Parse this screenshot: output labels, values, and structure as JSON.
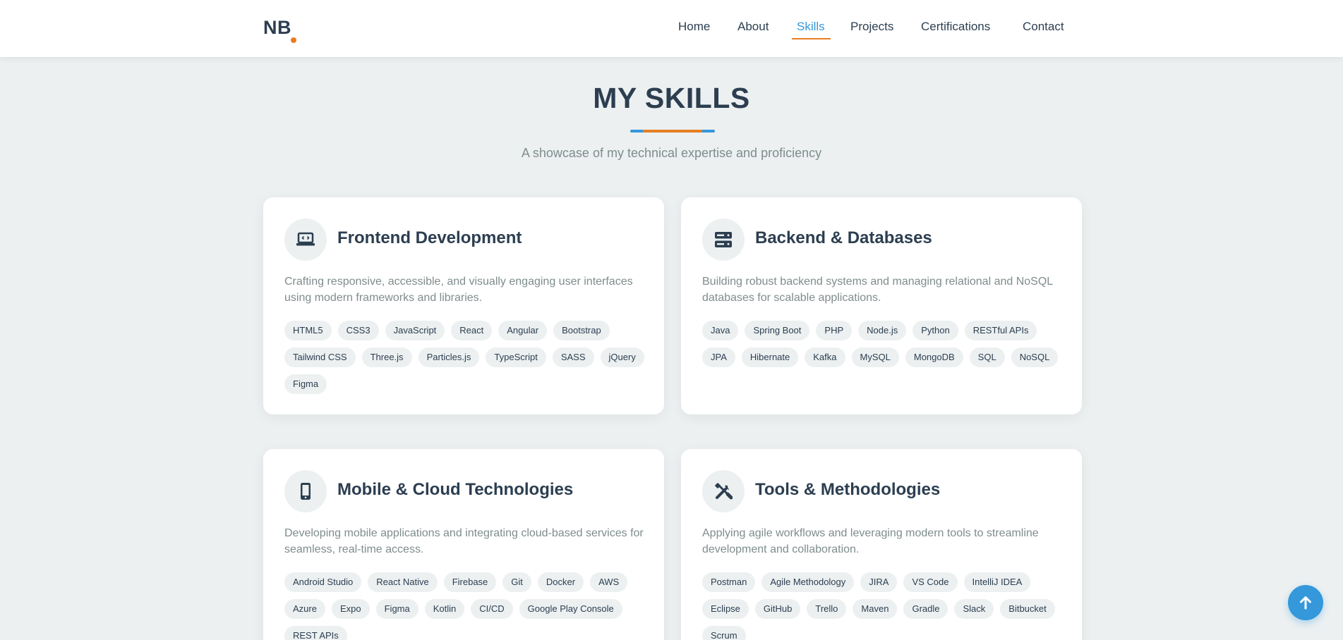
{
  "brand": {
    "logo_text": "NB",
    "accent": "#e67e22",
    "primary": "#3498db",
    "text": "#2c3e50"
  },
  "nav": {
    "items": [
      {
        "label": "Home"
      },
      {
        "label": "About"
      },
      {
        "label": "Skills",
        "active": true
      },
      {
        "label": "Projects"
      },
      {
        "label": "Certifications"
      },
      {
        "label": "Contact"
      }
    ]
  },
  "section": {
    "title": "MY SKILLS",
    "subtitle": "A showcase of my technical expertise and proficiency"
  },
  "cards": [
    {
      "icon": "laptop-code-icon",
      "title": "Frontend Development",
      "description": "Crafting responsive, accessible, and visually engaging user interfaces using modern frameworks and libraries.",
      "tags": [
        "HTML5",
        "CSS3",
        "JavaScript",
        "React",
        "Angular",
        "Bootstrap",
        "Tailwind CSS",
        "Three.js",
        "Particles.js",
        "TypeScript",
        "SASS",
        "jQuery",
        "Figma"
      ]
    },
    {
      "icon": "server-icon",
      "title": "Backend & Databases",
      "description": "Building robust backend systems and managing relational and NoSQL databases for scalable applications.",
      "tags": [
        "Java",
        "Spring Boot",
        "PHP",
        "Node.js",
        "Python",
        "RESTful APIs",
        "JPA",
        "Hibernate",
        "Kafka",
        "MySQL",
        "MongoDB",
        "SQL",
        "NoSQL"
      ]
    },
    {
      "icon": "mobile-icon",
      "title": "Mobile & Cloud Technologies",
      "description": "Developing mobile applications and integrating cloud-based services for seamless, real-time access.",
      "tags": [
        "Android Studio",
        "React Native",
        "Firebase",
        "Git",
        "Docker",
        "AWS",
        "Azure",
        "Expo",
        "Figma",
        "Kotlin",
        "CI/CD",
        "Google Play Console",
        "REST APIs"
      ]
    },
    {
      "icon": "tools-icon",
      "title": "Tools & Methodologies",
      "description": "Applying agile workflows and leveraging modern tools to streamline development and collaboration.",
      "tags": [
        "Postman",
        "Agile Methodology",
        "JIRA",
        "VS Code",
        "IntelliJ IDEA",
        "Eclipse",
        "GitHub",
        "Trello",
        "Maven",
        "Gradle",
        "Slack",
        "Bitbucket",
        "Scrum"
      ]
    }
  ],
  "scroll_top": {
    "icon": "arrow-up-icon"
  }
}
